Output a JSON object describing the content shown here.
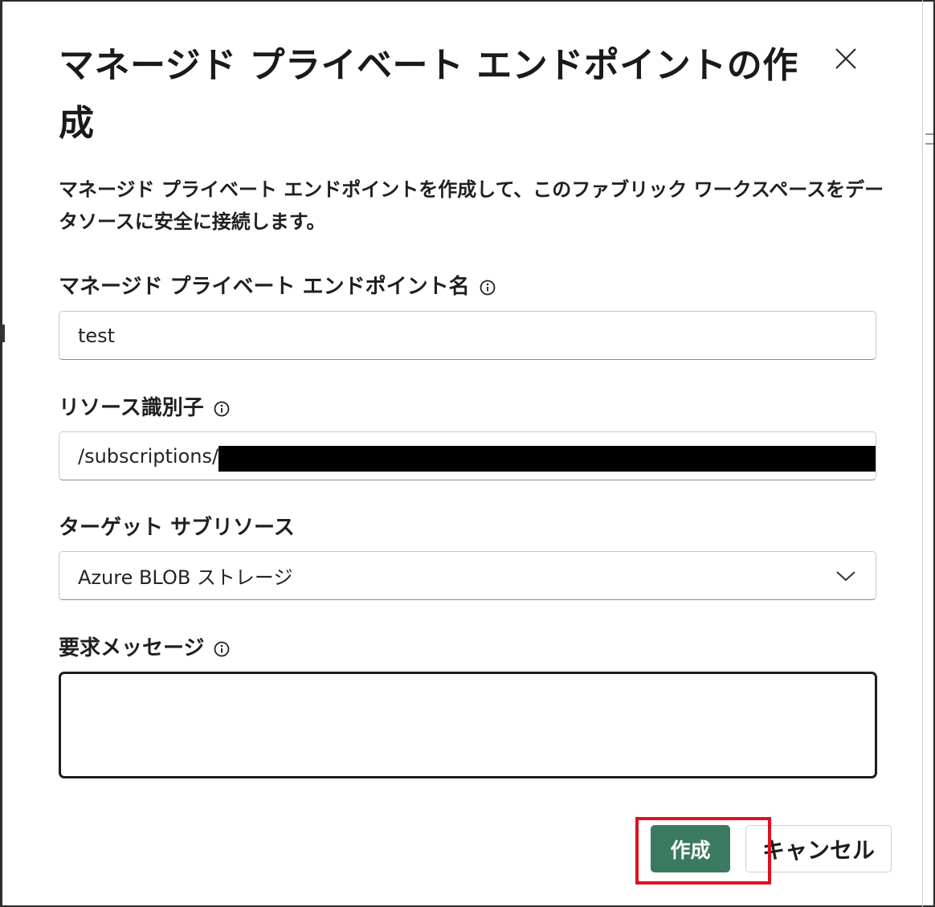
{
  "dialog": {
    "title": "マネージド プライベート エンドポイントの作成",
    "description": "マネージド プライベート エンドポイントを作成して、このファブリック ワークスペースをデータソースに安全に接続します。",
    "close_icon": "close-icon"
  },
  "fields": {
    "endpoint_name": {
      "label": "マネージド プライベート エンドポイント名",
      "value": "test",
      "icon": "info-icon"
    },
    "resource_id": {
      "label": "リソース識別子",
      "value": "/subscriptions/",
      "icon": "info-icon"
    },
    "target_subresource": {
      "label": "ターゲット サブリソース",
      "value": "Azure BLOB ストレージ",
      "icon": "chevron-down-icon"
    },
    "request_message": {
      "label": "要求メッセージ",
      "value": "",
      "icon": "info-icon"
    }
  },
  "buttons": {
    "create": "作成",
    "cancel": "キャンセル"
  },
  "colors": {
    "primary": "#3a7a60",
    "highlight": "#e0101e"
  }
}
